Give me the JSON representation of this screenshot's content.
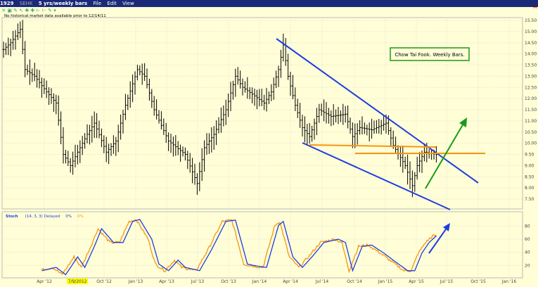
{
  "window": {
    "symbol": "1929",
    "exchange": "SEHK",
    "period": "5 yrs/weekly bars",
    "menu": [
      "File",
      "Edit",
      "View"
    ]
  },
  "note": "No historical market data available prior to 12/14/11",
  "chart_data": {
    "type": "line",
    "title": "Chow Tai Fook.  Weekly Bars.",
    "price_axis": {
      "ticks": [
        "15.50",
        "15.00",
        "14.50",
        "14.00",
        "13.50",
        "13.00",
        "12.50",
        "12.00",
        "11.50",
        "11.00",
        "10.50",
        "10.00",
        "9.50",
        "9.00",
        "8.50",
        "8.00",
        "7.50"
      ],
      "ylim": [
        7.0,
        15.8
      ]
    },
    "x_ticks": [
      "Apr '12",
      "7/9/2012",
      "Oct '12",
      "Jan '13",
      "Apr '13",
      "Jul '13",
      "Oct '13",
      "Jan '14",
      "Apr '14",
      "Jul '14",
      "Oct '14",
      "Jan '15",
      "Apr '15",
      "Jul '15",
      "Oct '15",
      "Jan '16"
    ],
    "price_waypoints_week_price": [
      [
        0,
        14.2
      ],
      [
        3,
        14.5
      ],
      [
        7,
        15.1
      ],
      [
        9,
        13.3
      ],
      [
        13,
        13.0
      ],
      [
        18,
        12.3
      ],
      [
        22,
        11.8
      ],
      [
        25,
        9.5
      ],
      [
        28,
        9.0
      ],
      [
        32,
        9.8
      ],
      [
        35,
        10.4
      ],
      [
        38,
        10.9
      ],
      [
        43,
        9.6
      ],
      [
        47,
        10.1
      ],
      [
        51,
        11.7
      ],
      [
        56,
        13.3
      ],
      [
        59,
        13.0
      ],
      [
        63,
        11.5
      ],
      [
        69,
        10.1
      ],
      [
        76,
        9.5
      ],
      [
        81,
        8.2
      ],
      [
        84,
        9.8
      ],
      [
        88,
        10.4
      ],
      [
        93,
        11.5
      ],
      [
        97,
        13.0
      ],
      [
        100,
        12.5
      ],
      [
        104,
        12.2
      ],
      [
        109,
        11.8
      ],
      [
        112,
        12.3
      ],
      [
        115,
        13.3
      ],
      [
        117,
        14.4
      ],
      [
        119,
        13.0
      ],
      [
        122,
        11.7
      ],
      [
        125,
        10.7
      ],
      [
        128,
        10.3
      ],
      [
        132,
        11.5
      ],
      [
        137,
        11.2
      ],
      [
        143,
        11.3
      ],
      [
        146,
        10.3
      ],
      [
        149,
        10.7
      ],
      [
        154,
        10.6
      ],
      [
        160,
        10.9
      ],
      [
        163,
        9.9
      ],
      [
        168,
        9.0
      ],
      [
        171,
        8.1
      ],
      [
        173,
        9.0
      ],
      [
        176,
        9.6
      ],
      [
        181,
        9.5
      ]
    ],
    "stoch": {
      "label": "Stoch",
      "params": "(14, 3, 3) Delayed",
      "legend": [
        "0%",
        "0%"
      ],
      "ticks": [
        "80",
        "60",
        "40",
        "20"
      ],
      "ylim": [
        0,
        100
      ],
      "waypoints_week_value": [
        [
          16,
          12
        ],
        [
          22,
          17
        ],
        [
          26,
          6
        ],
        [
          31,
          33
        ],
        [
          34,
          17
        ],
        [
          38,
          49
        ],
        [
          41,
          76
        ],
        [
          46,
          55
        ],
        [
          50,
          55
        ],
        [
          54,
          87
        ],
        [
          57,
          90
        ],
        [
          62,
          60
        ],
        [
          65,
          22
        ],
        [
          69,
          12
        ],
        [
          73,
          28
        ],
        [
          76,
          17
        ],
        [
          82,
          12
        ],
        [
          87,
          44
        ],
        [
          93,
          87
        ],
        [
          97,
          89
        ],
        [
          102,
          22
        ],
        [
          106,
          19
        ],
        [
          110,
          17
        ],
        [
          115,
          81
        ],
        [
          117,
          87
        ],
        [
          121,
          33
        ],
        [
          125,
          17
        ],
        [
          129,
          33
        ],
        [
          134,
          55
        ],
        [
          140,
          60
        ],
        [
          143,
          55
        ],
        [
          146,
          12
        ],
        [
          150,
          49
        ],
        [
          154,
          51
        ],
        [
          159,
          39
        ],
        [
          163,
          28
        ],
        [
          169,
          12
        ],
        [
          172,
          12
        ],
        [
          175,
          39
        ],
        [
          178,
          55
        ],
        [
          181,
          65
        ]
      ]
    },
    "colors": {
      "bars": "#000000",
      "trend": "#1f3de0",
      "support": "#f5960f",
      "arrow_up": "#1a9a1a",
      "k": "#1f3de0",
      "d": "#f5960f"
    }
  }
}
